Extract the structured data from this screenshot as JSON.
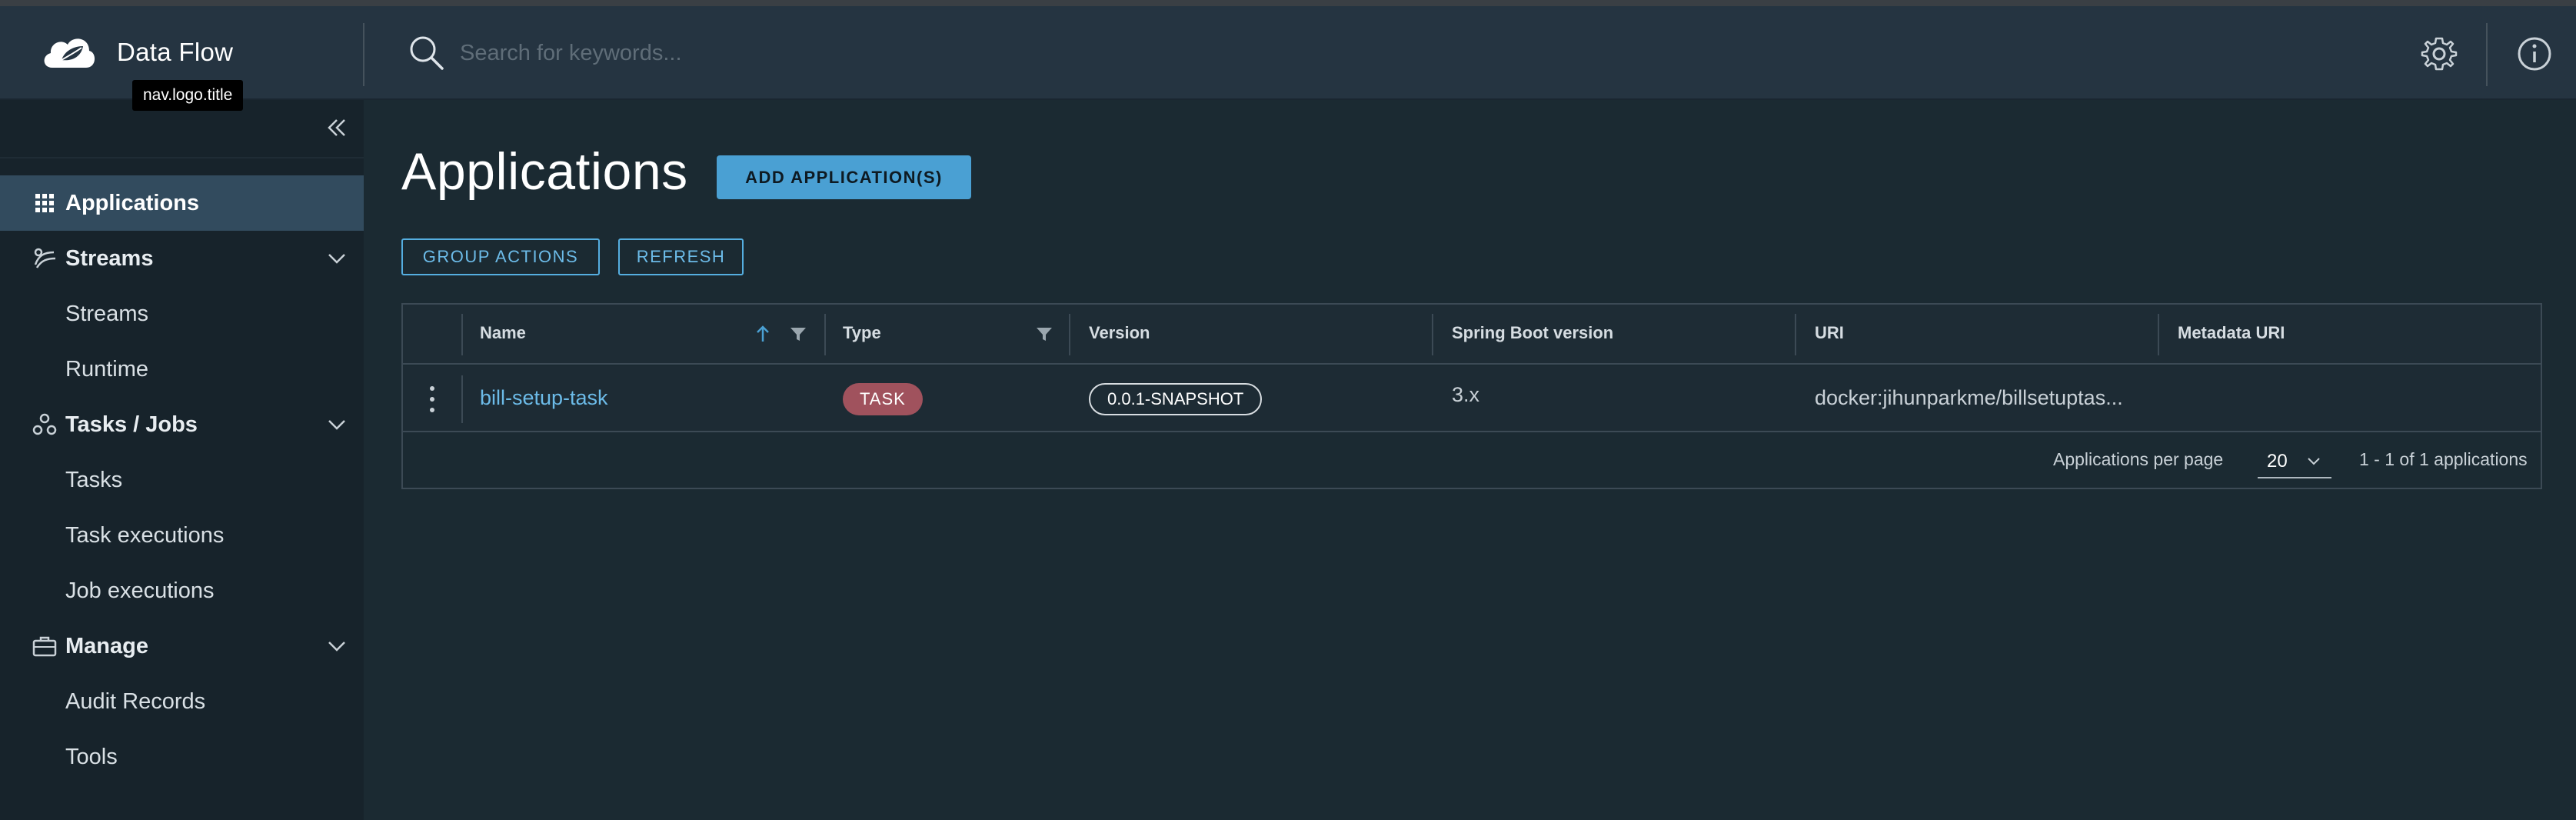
{
  "app": {
    "title": "Data Flow",
    "tooltip": "nav.logo.title"
  },
  "search": {
    "placeholder": "Search for keywords..."
  },
  "header_icons": [
    "gear-icon",
    "info-icon"
  ],
  "sidebar": {
    "items": [
      {
        "label": "Applications",
        "icon": "grid-icon",
        "active": true
      },
      {
        "label": "Streams",
        "icon": "streams-icon",
        "group": true
      },
      {
        "label": "Streams"
      },
      {
        "label": "Runtime"
      },
      {
        "label": "Tasks / Jobs",
        "icon": "tasks-icon",
        "group": true
      },
      {
        "label": "Tasks"
      },
      {
        "label": "Task executions"
      },
      {
        "label": "Job executions"
      },
      {
        "label": "Manage",
        "icon": "briefcase-icon",
        "group": true
      },
      {
        "label": "Audit Records"
      },
      {
        "label": "Tools"
      }
    ]
  },
  "main": {
    "title": "Applications",
    "add_button": "ADD APPLICATION(S)",
    "group_actions": "GROUP ACTIONS",
    "refresh": "REFRESH"
  },
  "table": {
    "columns": [
      "Name",
      "Type",
      "Version",
      "Spring Boot version",
      "URI",
      "Metadata URI"
    ],
    "rows": [
      {
        "name": "bill-setup-task",
        "type": "TASK",
        "version": "0.0.1-SNAPSHOT",
        "spring_boot_version": "3.x",
        "uri": "docker:jihunparkme/billsetuptas...",
        "metadata_uri": ""
      }
    ],
    "footer": {
      "per_page_label": "Applications per page",
      "per_page_value": "20",
      "range_label": "1 - 1 of 1 applications"
    }
  },
  "colors": {
    "accent": "#4aa0d3",
    "task_badge": "#a0525d",
    "active_nav": "#324b5e"
  }
}
